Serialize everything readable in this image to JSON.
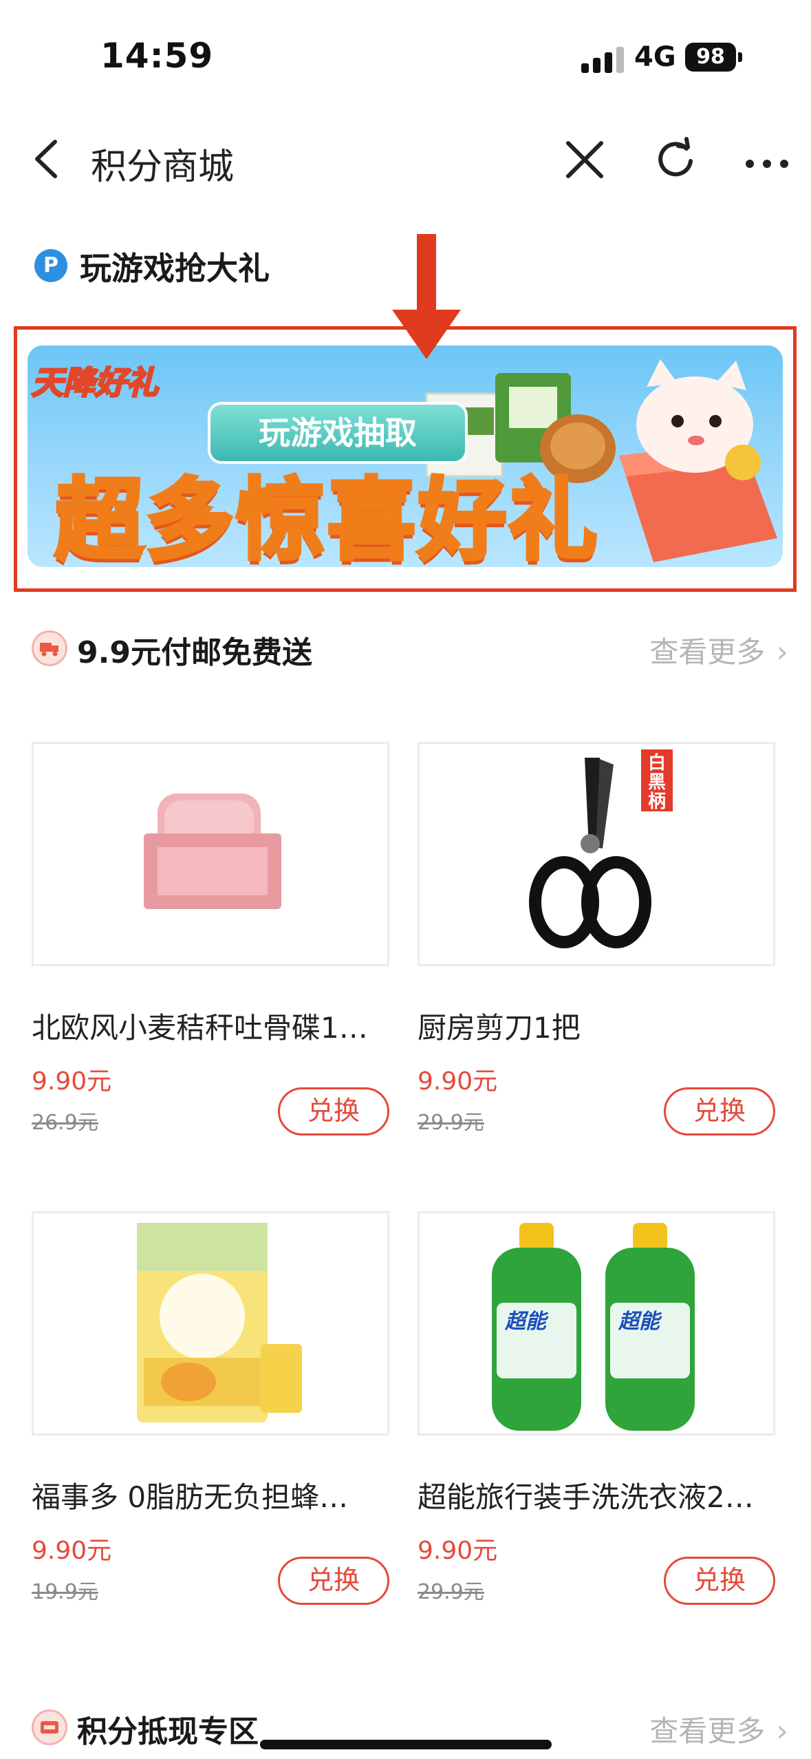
{
  "status_bar": {
    "time": "14:59",
    "network": "4G",
    "battery": "98"
  },
  "nav": {
    "title": "积分商城"
  },
  "game_section": {
    "icon_letter": "P",
    "title": "玩游戏抢大礼",
    "banner": {
      "tag": "天降好礼",
      "pill": "玩游戏抽取",
      "headline": "超多惊喜好礼"
    }
  },
  "shipping_section": {
    "title": "9.9元付邮免费送",
    "more": "查看更多",
    "products": [
      {
        "name": "北欧风小麦秸秆吐骨碟1…",
        "price": "9.90元",
        "original_price": "26.9元",
        "button": "兑换"
      },
      {
        "name": "厨房剪刀1把",
        "price": "9.90元",
        "original_price": "29.9元",
        "button": "兑换",
        "image_label": "白黑柄"
      },
      {
        "name": "福事多 0脂肪无负担蜂…",
        "price": "9.90元",
        "original_price": "19.9元",
        "button": "兑换"
      },
      {
        "name": "超能旅行装手洗洗衣液2…",
        "price": "9.90元",
        "original_price": "29.9元",
        "button": "兑换",
        "image_label": "超能"
      }
    ]
  },
  "cash_section": {
    "title": "积分抵现专区",
    "more": "查看更多"
  },
  "colors": {
    "accent_red": "#e5493a",
    "annotation_red": "#e03a1e",
    "banner_sky": "#6cc6f6"
  }
}
